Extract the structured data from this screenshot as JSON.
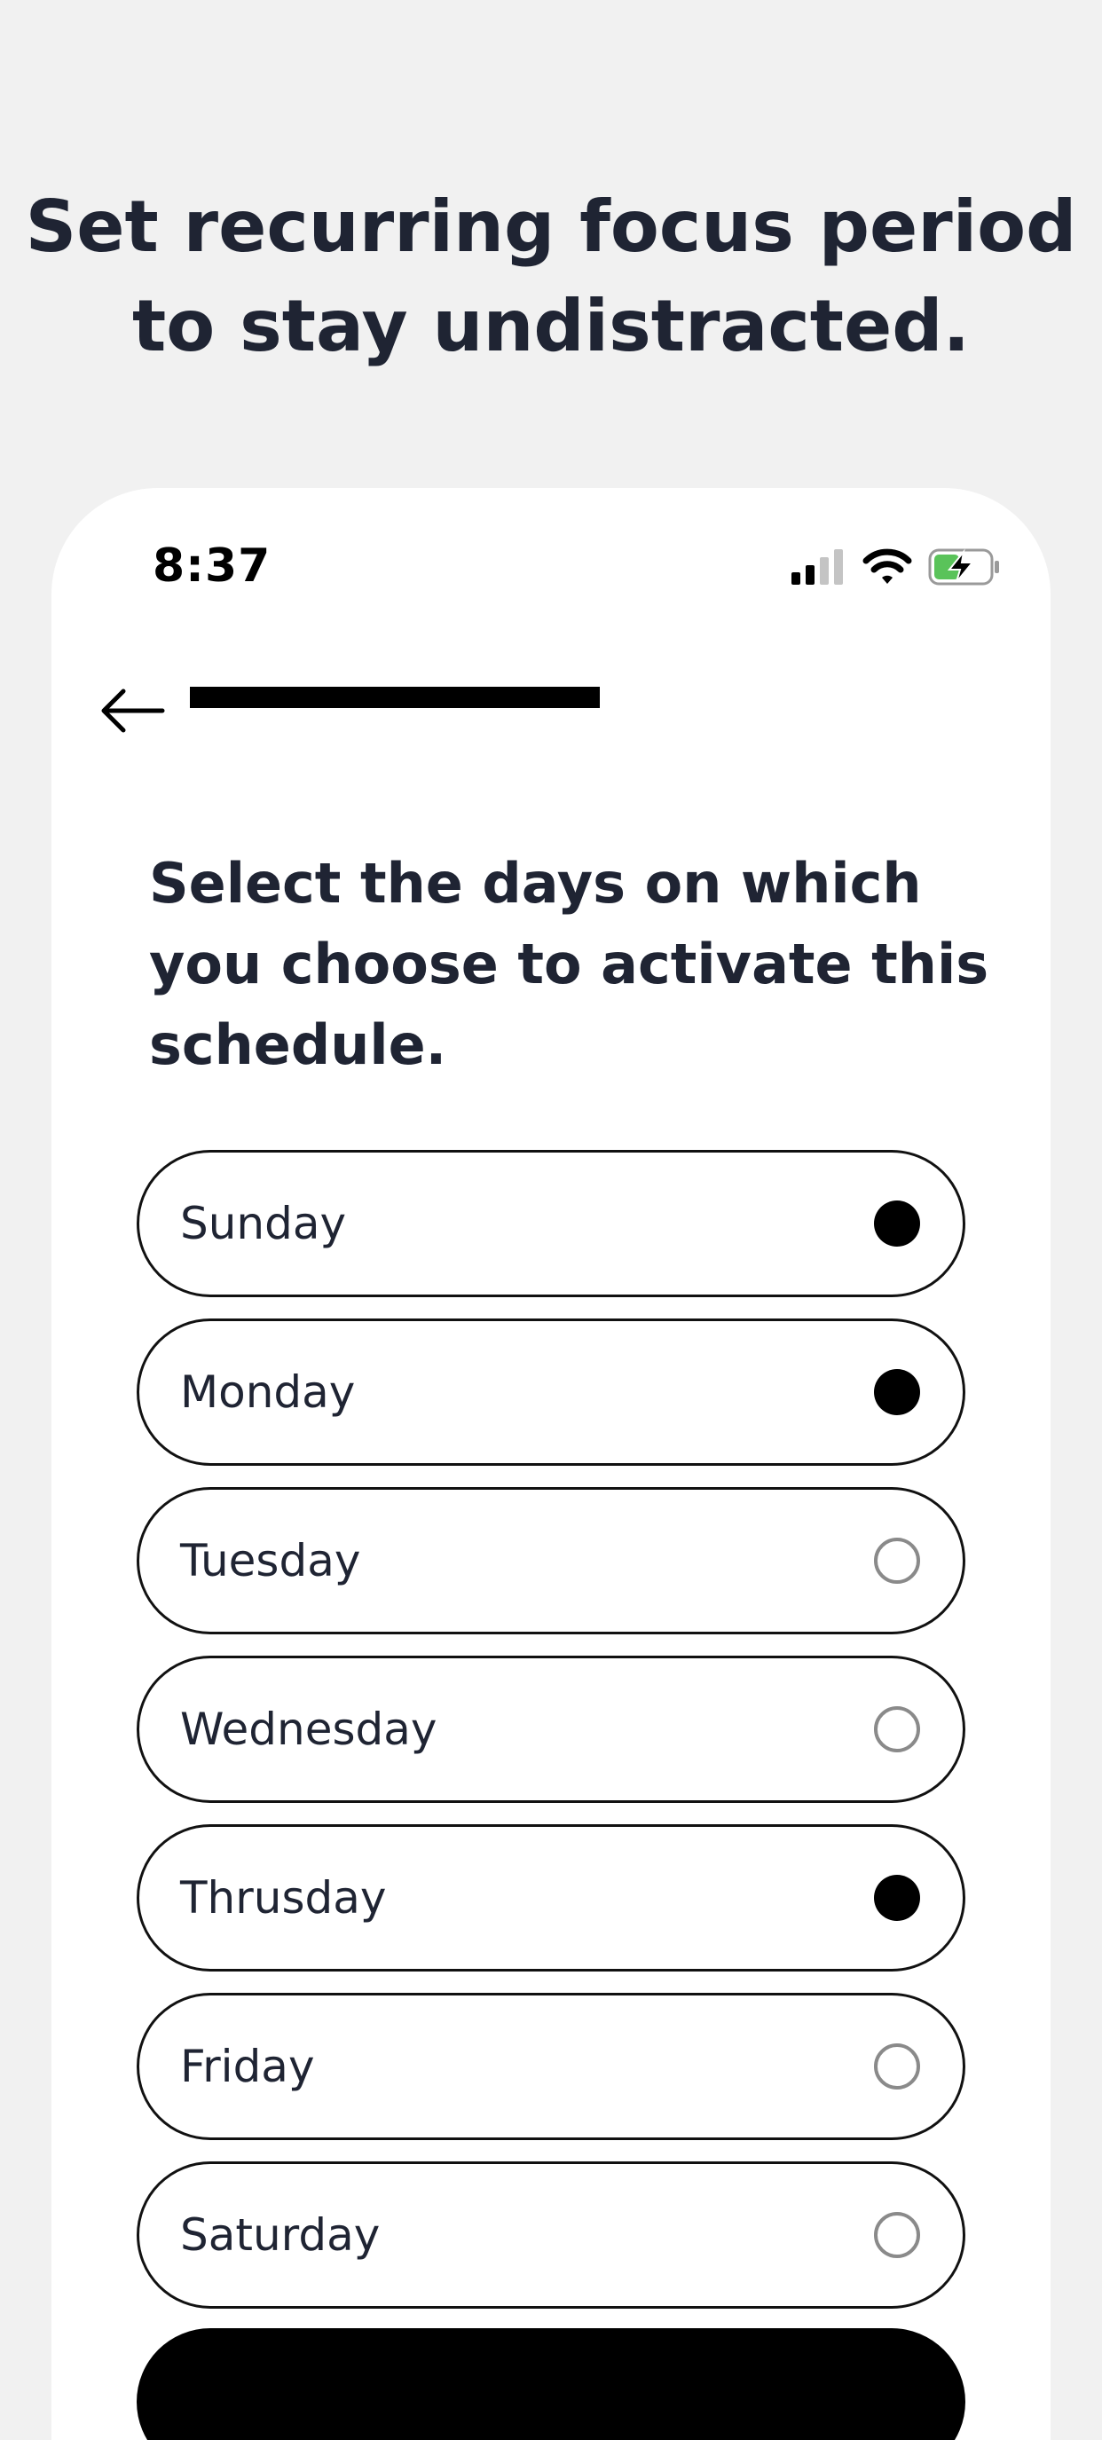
{
  "headline": {
    "line1": "Set recurring focus period",
    "line2": "to stay undistracted."
  },
  "status_bar": {
    "time": "8:37",
    "icons": [
      "cellular-signal-icon",
      "wifi-icon",
      "battery-charging-icon"
    ],
    "battery_color": "#5ac35a"
  },
  "nav": {
    "back_icon": "arrow-left-icon",
    "progress": 1.0
  },
  "question": "Select the days on which you choose to activate this schedule.",
  "days": [
    {
      "label": "Sunday",
      "selected": true
    },
    {
      "label": "Monday",
      "selected": true
    },
    {
      "label": "Tuesday",
      "selected": false
    },
    {
      "label": "Wednesday",
      "selected": false
    },
    {
      "label": "Thrusday",
      "selected": true
    },
    {
      "label": "Friday",
      "selected": false
    },
    {
      "label": "Saturday",
      "selected": false
    }
  ],
  "colors": {
    "background": "#f1f1f1",
    "card": "#ffffff",
    "text": "#1f2433",
    "accent": "#000000",
    "radio_off_border": "#8a8a8a"
  }
}
